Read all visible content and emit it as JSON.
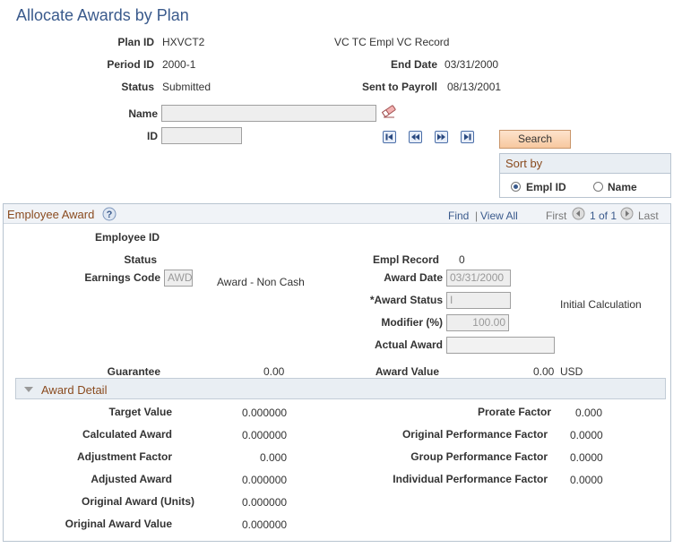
{
  "page": {
    "title": "Allocate Awards by Plan"
  },
  "header": {
    "plan_id_label": "Plan ID",
    "plan_id": "HXVCT2",
    "plan_desc": "VC TC Empl VC Record",
    "period_id_label": "Period ID",
    "period_id": "2000-1",
    "end_date_label": "End Date",
    "end_date": "03/31/2000",
    "status_label": "Status",
    "status": "Submitted",
    "sent_label": "Sent to Payroll",
    "sent_date": "08/13/2001"
  },
  "search": {
    "name_label": "Name",
    "name_value": "",
    "id_label": "ID",
    "id_value": "",
    "button": "Search",
    "sort_title": "Sort by",
    "sort_options": [
      "Empl ID",
      "Name"
    ],
    "sort_selected": "Empl ID"
  },
  "employee_award": {
    "title": "Employee Award",
    "find": "Find",
    "sep": "|",
    "view_all": "View All",
    "first": "First",
    "paging": "1 of 1",
    "last": "Last",
    "empl_id_label": "Employee ID",
    "status_label": "Status",
    "empl_record_label": "Empl Record",
    "empl_record": "0",
    "earnings_code_label": "Earnings Code",
    "earnings_code": "AWD",
    "earnings_desc": "Award - Non Cash",
    "award_date_label": "Award Date",
    "award_date": "03/31/2000",
    "award_status_label": "*Award Status",
    "award_status": "I",
    "award_status_desc": "Initial Calculation",
    "modifier_label": "Modifier (%)",
    "modifier": "100.00",
    "actual_award_label": "Actual Award",
    "actual_award": "",
    "guarantee_label": "Guarantee",
    "guarantee": "0.00",
    "award_value_label": "Award Value",
    "award_value": "0.00",
    "currency": "USD"
  },
  "award_detail": {
    "title": "Award Detail",
    "left": [
      {
        "label": "Target Value",
        "value": "0.000000"
      },
      {
        "label": "Calculated Award",
        "value": "0.000000"
      },
      {
        "label": "Adjustment Factor",
        "value": "0.000"
      },
      {
        "label": "Adjusted Award",
        "value": "0.000000"
      },
      {
        "label": "Original Award (Units)",
        "value": "0.000000"
      },
      {
        "label": "Original Award Value",
        "value": "0.000000"
      }
    ],
    "right": [
      {
        "label": "Prorate Factor",
        "value": "0.000"
      },
      {
        "label": "Original Performance Factor",
        "value": "0.0000"
      },
      {
        "label": "Group Performance Factor",
        "value": "0.0000"
      },
      {
        "label": "Individual Performance Factor",
        "value": "0.0000"
      }
    ]
  },
  "icons": [
    "eraser-icon",
    "first-icon",
    "previous-icon",
    "next-icon",
    "last-icon",
    "help-icon",
    "collapse-icon"
  ],
  "colors": {
    "title": "#3a5a8c",
    "section_header": "#8a4b1f",
    "button": "#f7c89f",
    "panel_border": "#b8c4d0"
  }
}
